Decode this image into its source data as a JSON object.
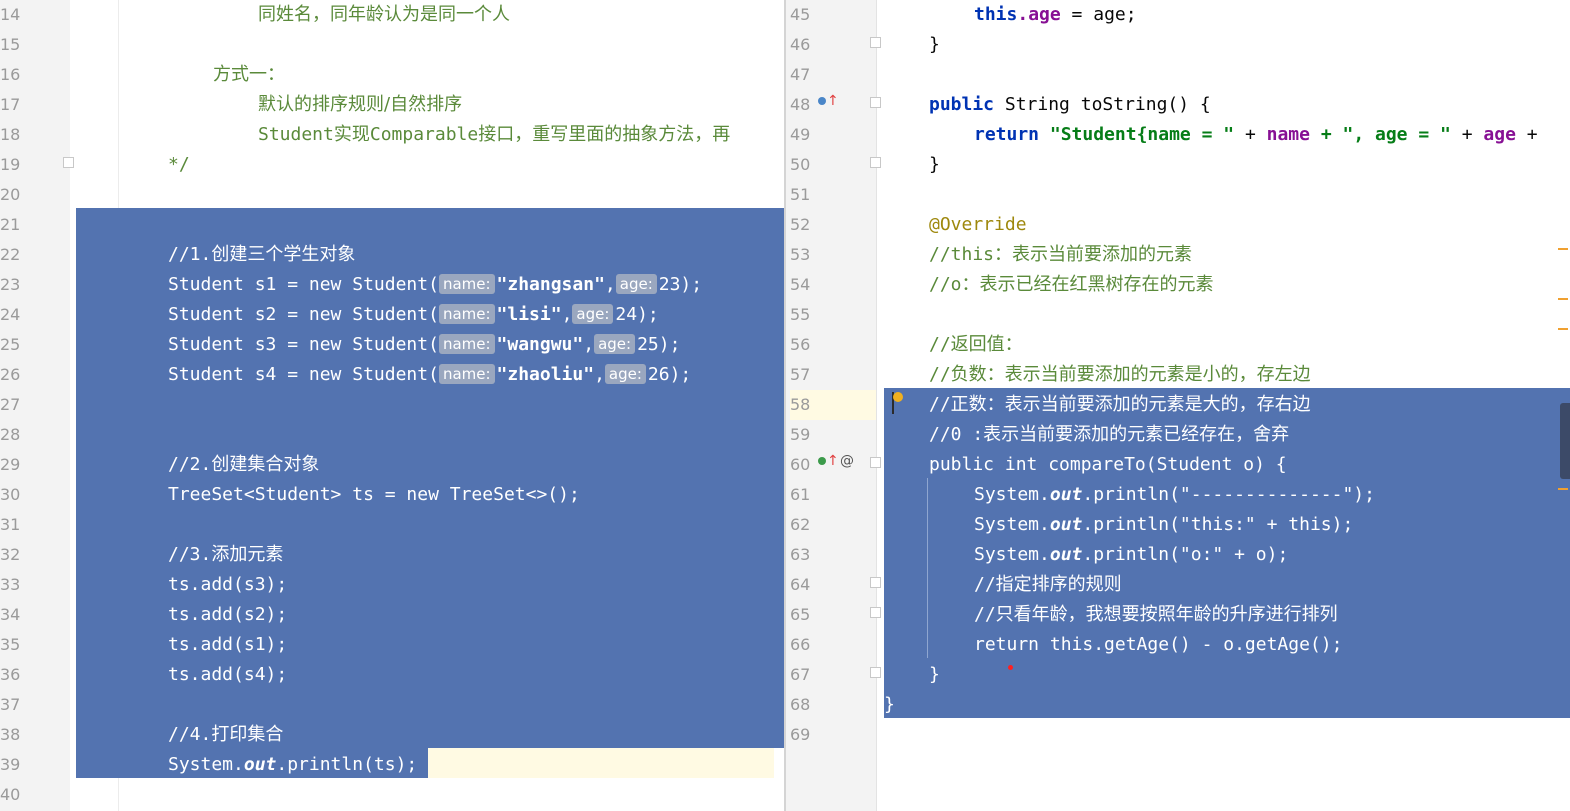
{
  "left_editor": {
    "lines": [
      {
        "n": "14",
        "t": "同姓名，同年龄认为是同一个人"
      },
      {
        "n": "15",
        "t": ""
      },
      {
        "n": "16",
        "t": "方式一："
      },
      {
        "n": "17",
        "t": "默认的排序规则/自然排序"
      },
      {
        "n": "18",
        "t": "Student实现Comparable接口，重写里面的抽象方法，再"
      },
      {
        "n": "19",
        "t": "*/"
      },
      {
        "n": "20",
        "t": ""
      },
      {
        "n": "21",
        "t": ""
      },
      {
        "n": "22",
        "t": "//1.创建三个学生对象"
      },
      {
        "n": "23",
        "a": "Student s1 = new Student(",
        "h1": "name:",
        "s": "\"zhangsan\"",
        "c": ",",
        "h2": "age:",
        "v": "23);"
      },
      {
        "n": "24",
        "a": "Student s2 = new Student(",
        "h1": "name:",
        "s": "\"lisi\"",
        "c": ",",
        "h2": "age:",
        "v": "24);"
      },
      {
        "n": "25",
        "a": "Student s3 = new Student(",
        "h1": "name:",
        "s": "\"wangwu\"",
        "c": ",",
        "h2": "age:",
        "v": "25);"
      },
      {
        "n": "26",
        "a": "Student s4 = new Student(",
        "h1": "name:",
        "s": "\"zhaoliu\"",
        "c": ",",
        "h2": "age:",
        "v": "26);"
      },
      {
        "n": "27",
        "t": ""
      },
      {
        "n": "28",
        "t": ""
      },
      {
        "n": "29",
        "t": "//2.创建集合对象"
      },
      {
        "n": "30",
        "t": "TreeSet<Student> ts = new TreeSet<>();"
      },
      {
        "n": "31",
        "t": ""
      },
      {
        "n": "32",
        "t": "//3.添加元素"
      },
      {
        "n": "33",
        "t": "ts.add(s3);"
      },
      {
        "n": "34",
        "t": "ts.add(s2);"
      },
      {
        "n": "35",
        "t": "ts.add(s1);"
      },
      {
        "n": "36",
        "t": "ts.add(s4);"
      },
      {
        "n": "37",
        "t": ""
      },
      {
        "n": "38",
        "t": "//4.打印集合"
      },
      {
        "n": "39",
        "a": "System.",
        "o": "out",
        "b": ".println(ts);"
      },
      {
        "n": "40",
        "t": ""
      }
    ]
  },
  "right_editor": {
    "lines": [
      {
        "n": "45",
        "a": "this",
        "f": ".age",
        "b": " = age;"
      },
      {
        "n": "46",
        "t": "}"
      },
      {
        "n": "47",
        "t": ""
      },
      {
        "n": "48",
        "k": "public",
        "t": " String toString() {"
      },
      {
        "n": "49",
        "k": "return",
        "s": " \"Student{name = \"",
        "b": " + ",
        "f": "name",
        "s2": " + \", age = \"",
        "b2": " + ",
        "f2": "age",
        "b3": " +"
      },
      {
        "n": "50",
        "t": "}"
      },
      {
        "n": "51",
        "t": ""
      },
      {
        "n": "52",
        "an": "@Override"
      },
      {
        "n": "53",
        "c": "//this：表示当前要添加的元素"
      },
      {
        "n": "54",
        "c": "//o：表示已经在红黑树存在的元素"
      },
      {
        "n": "55",
        "t": ""
      },
      {
        "n": "56",
        "c": "//返回值："
      },
      {
        "n": "57",
        "c": "//负数：表示当前要添加的元素是小的，存左边"
      },
      {
        "n": "58",
        "c": "//正数：表示当前要添加的元素是大的，存右边"
      },
      {
        "n": "59",
        "c": "//0 :表示当前要添加的元素已经存在，舍弃"
      },
      {
        "n": "60",
        "t": "public int compareTo(Student o) {"
      },
      {
        "n": "61",
        "a": "System.",
        "o": "out",
        "b": ".println(\"--------------\");"
      },
      {
        "n": "62",
        "a": "System.",
        "o": "out",
        "b": ".println(\"this:\" + this);"
      },
      {
        "n": "63",
        "a": "System.",
        "o": "out",
        "b": ".println(\"o:\" + o);"
      },
      {
        "n": "64",
        "c": "//指定排序的规则"
      },
      {
        "n": "65",
        "c": "//只看年龄，我想要按照年龄的升序进行排列"
      },
      {
        "n": "66",
        "t": "return this.getAge() - o.getAge();"
      },
      {
        "n": "67",
        "t": "}"
      },
      {
        "n": "68",
        "t": "}"
      },
      {
        "n": "69",
        "t": ""
      }
    ],
    "gutter_icons": {
      "override_up": "↑",
      "at": "@"
    }
  },
  "colors": {
    "selection": "#5373b0",
    "keyword": "#0033b3",
    "string": "#067d17",
    "field": "#871094",
    "comment": "#8c8c8c",
    "annotation": "#9e880d",
    "current_line": "#fffae3"
  }
}
